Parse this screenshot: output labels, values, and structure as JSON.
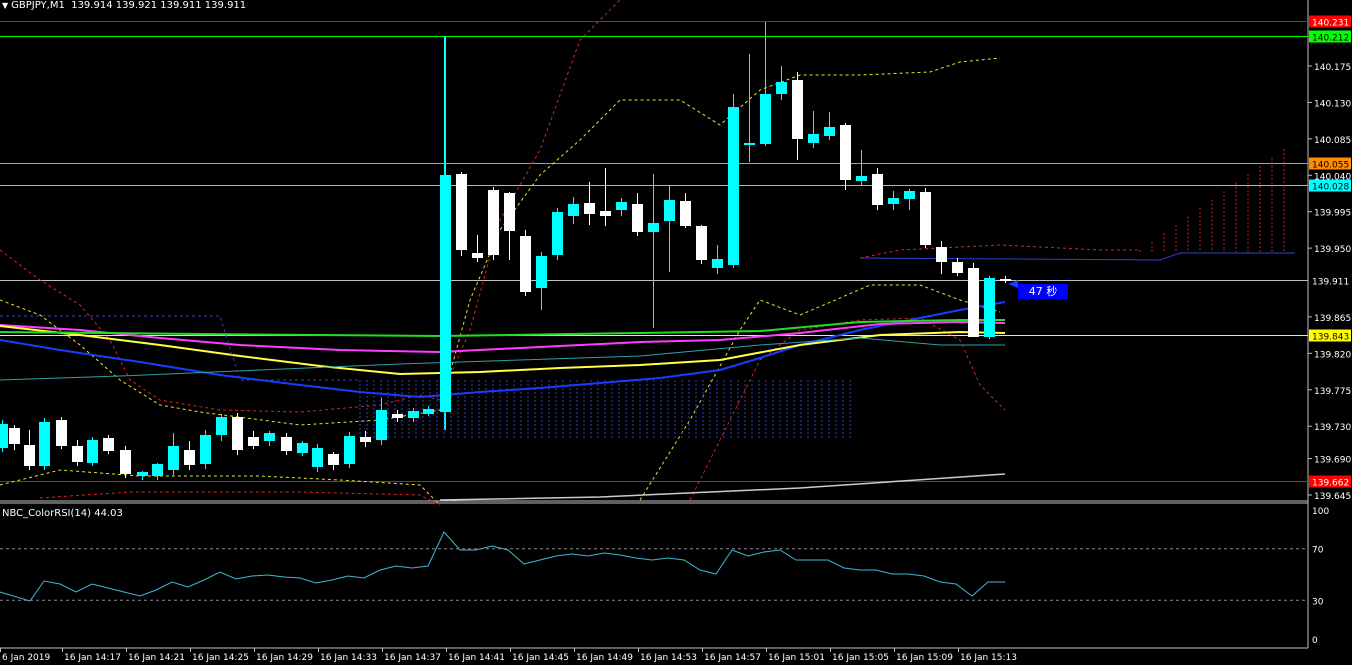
{
  "header": {
    "symbol_timeframe": "GBPJPY,M1",
    "ohlc": "139.914 139.921 139.911 139.911"
  },
  "countdown": "47 秒",
  "price_axis": {
    "ticks": [
      "140.175",
      "140.130",
      "140.085",
      "140.040",
      "139.995",
      "139.950",
      "139.865",
      "139.820",
      "139.775",
      "139.730",
      "139.690",
      "139.645"
    ],
    "levels": [
      {
        "label": "140.231",
        "bg": "#ff0000",
        "fg": "#ffffff",
        "line": "#ff0000"
      },
      {
        "label": "140.212",
        "bg": "#00ff00",
        "fg": "#000000",
        "line": "#00ff00"
      },
      {
        "label": "140.055",
        "bg": "#ff8c00",
        "fg": "#000000",
        "line": "#ff8c00"
      },
      {
        "label": "140.028",
        "bg": "#00ffff",
        "fg": "#000000",
        "line": "#00ffff"
      },
      {
        "label": "139.911",
        "bg": "#000000",
        "fg": "#ffffff",
        "line": "#bfbfbf"
      },
      {
        "label": "139.843",
        "bg": "#ffff00",
        "fg": "#000000",
        "line": "#ffff00"
      },
      {
        "label": "139.662",
        "bg": "#ff0000",
        "fg": "#ffffff",
        "line": "#ff0000"
      }
    ]
  },
  "rsi": {
    "title": "NBC_ColorRSI(14) 44.03",
    "ticks": [
      "100",
      "70",
      "30",
      "0"
    ],
    "line_color": "#3fb8d8"
  },
  "time_axis": [
    "6 Jan 2019",
    "16 Jan 14:17",
    "16 Jan 14:21",
    "16 Jan 14:25",
    "16 Jan 14:29",
    "16 Jan 14:33",
    "16 Jan 14:37",
    "16 Jan 14:41",
    "16 Jan 14:45",
    "16 Jan 14:49",
    "16 Jan 14:53",
    "16 Jan 14:57",
    "16 Jan 15:01",
    "16 Jan 15:05",
    "16 Jan 15:09",
    "16 Jan 15:13"
  ],
  "colors": {
    "bull": "#00ffff",
    "bear": "#ffffff",
    "ma_blue": "#1a3cff",
    "ma_magenta": "#ff3dff",
    "ma_yellow": "#ffff44",
    "ma_green": "#22dd22",
    "bb_outer": "#dd2222",
    "bb_inner": "#e6e62e",
    "cloud": "#2f3fcc"
  }
}
